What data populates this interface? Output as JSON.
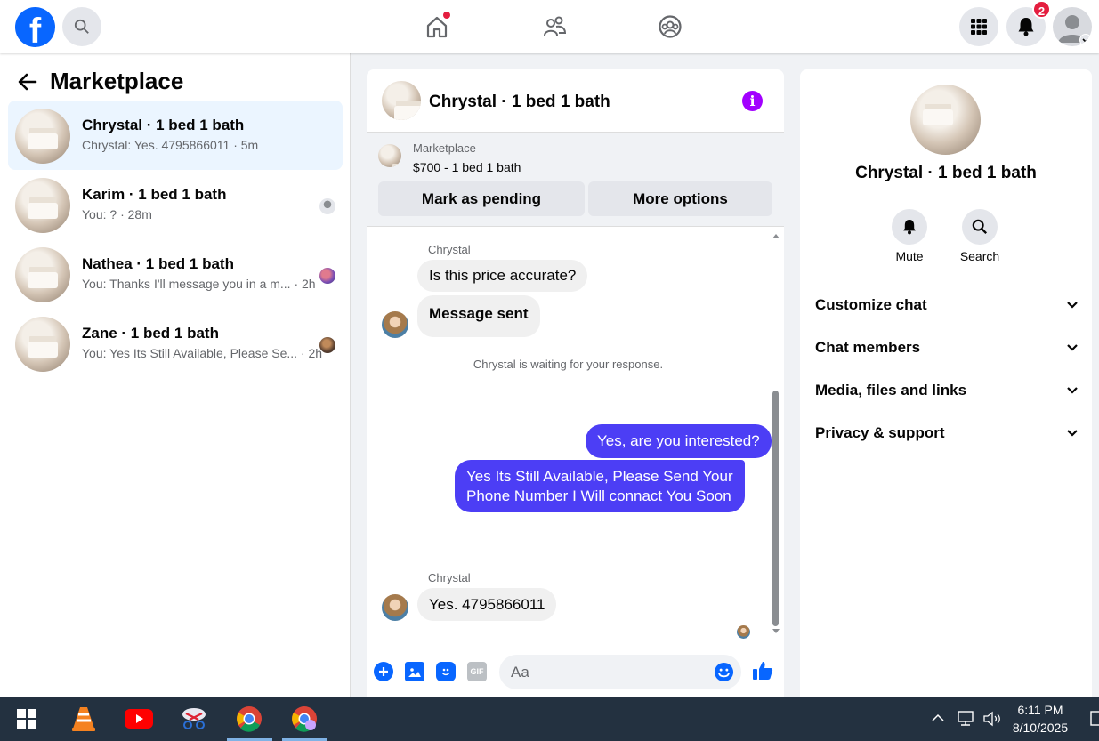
{
  "topbar": {
    "logo": "f",
    "notifications_count": "2",
    "icons": [
      "facebook-logo",
      "search-icon",
      "home-icon",
      "friends-icon",
      "groups-icon",
      "menu-grid-icon",
      "bell-icon",
      "profile-avatar"
    ]
  },
  "sidebar": {
    "title": "Marketplace",
    "threads": [
      {
        "name": "Chrystal · 1 bed 1 bath",
        "snippet": "Chrystal: Yes. 4795866011 · 5m",
        "active": true
      },
      {
        "name": "Karim · 1 bed 1 bath",
        "snippet": "You: ? · 28m"
      },
      {
        "name": "Nathea · 1 bed 1 bath",
        "snippet": "You: Thanks I'll message you in a m... · 2h"
      },
      {
        "name": "Zane · 1 bed 1 bath",
        "snippet": "You: Yes Its Still Available, Please Se... · 2h"
      }
    ]
  },
  "chat": {
    "title": "Chrystal · 1 bed 1 bath",
    "marketplace_label": "Marketplace",
    "listing": "$700 - 1 bed 1 bath",
    "mark_pending": "Mark as pending",
    "more_options": "More options",
    "messages": {
      "sender": "Chrystal",
      "m1": "Is this price accurate?",
      "m2": "Message sent",
      "system": "Chrystal is waiting for your response.",
      "m3": "Yes, are you interested?",
      "m4_line1": "Yes Its Still Available, Please Send Your",
      "m4_line2": "Phone Number I Will connact You Soon",
      "m5": "Yes. 4795866011"
    },
    "composer_placeholder": "Aa",
    "gif_label": "GIF"
  },
  "details": {
    "name": "Chrystal · 1 bed 1 bath",
    "mute": "Mute",
    "search": "Search",
    "sections": [
      "Customize chat",
      "Chat members",
      "Media, files and links",
      "Privacy & support"
    ]
  },
  "taskbar": {
    "time": "6:11 PM",
    "date": "8/10/2025"
  },
  "colors": {
    "brand": "#0866ff",
    "my_bubble": "#4c3ef5",
    "info": "#a200ff",
    "badge": "#e41e3f"
  }
}
